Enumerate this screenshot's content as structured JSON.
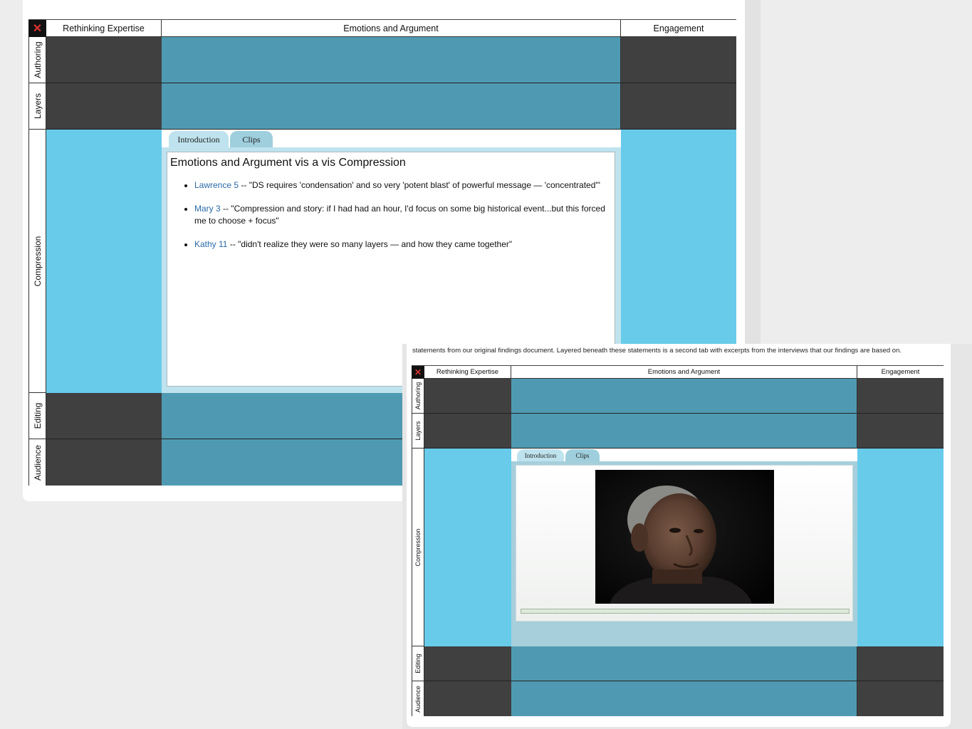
{
  "intro_text": "statements from our original findings document. Layered beneath these statements is a second tab with excerpts from the interviews that our findings are based on.",
  "corner_icon": "close-icon",
  "close_glyph": "✕",
  "columns": [
    "Rethinking Expertise",
    "Emotions and Argument",
    "Engagement"
  ],
  "rows": [
    "Authoring",
    "Layers",
    "Compression",
    "Editing",
    "Audience"
  ],
  "tabs": {
    "introduction": "Introduction",
    "clips": "Clips"
  },
  "popup": {
    "title": "Emotions and Argument vis a vis Compression",
    "clips": [
      {
        "link": "Lawrence 5",
        "sep": " -- ",
        "quote": "\"DS requires 'condensation' and so very 'potent blast' of powerful message — 'concentrated'\""
      },
      {
        "link": "Mary 3",
        "sep": " -- ",
        "quote": "\"Compression and story: if I had had an hour, I'd focus on some big historical event...but this forced me to choose + focus\""
      },
      {
        "link": "Kathy 11",
        "sep": " -- ",
        "quote": "\"didn't realize they were so many layers — and how they came together\""
      }
    ]
  },
  "video": {
    "progress": 1.0
  },
  "colors": {
    "dark": "#404040",
    "teal": "#4f9ab2",
    "light": "#68cbea",
    "link": "#2a6aa8"
  }
}
